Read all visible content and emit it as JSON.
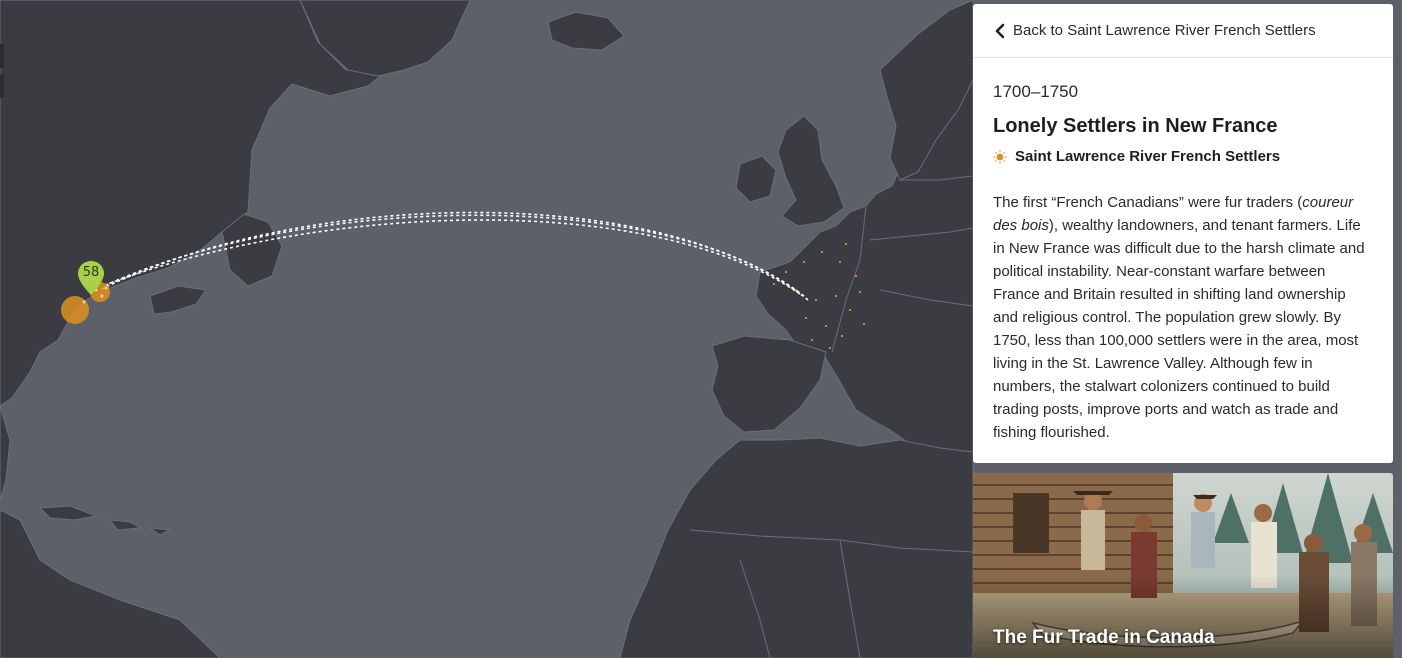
{
  "colors": {
    "ocean": "#5c6068",
    "land": "#3a3c42",
    "border": "#6b6e75",
    "marker_green": "#a8d14b",
    "settler_orange": "#e0901e",
    "panel_bg": "#ffffff"
  },
  "map": {
    "cluster_marker": {
      "count": "58"
    },
    "route": {
      "from": "France",
      "to": "Saint Lawrence River",
      "style": "dashed-white-arc"
    }
  },
  "panel": {
    "back_label": "Back to Saint Lawrence River French Settlers",
    "back_icon": "chevron-left-icon",
    "date_range": "1700–1750",
    "title": "Lonely Settlers in New France",
    "group_icon": "sun-dot-icon",
    "group_label": "Saint Lawrence River French Settlers",
    "body": {
      "p1": "The first “French Canadians” were fur traders (",
      "italic": "coureur des bois",
      "p2": "), wealthy landowners, and tenant farmers. Life in New France was difficult due to the harsh climate and political instability. Near-constant warfare between France and Britain resulted in shifting land ownership and religious control. The population grew slowly. By 1750, less than 100,000 settlers were in the area, most living in the St. Lawrence Valley. Although few in numbers, the stalwart colonizers continued to build trading posts, improve ports and watch as trade and fishing flourished."
    }
  },
  "card": {
    "title": "The Fur Trade in Canada"
  }
}
